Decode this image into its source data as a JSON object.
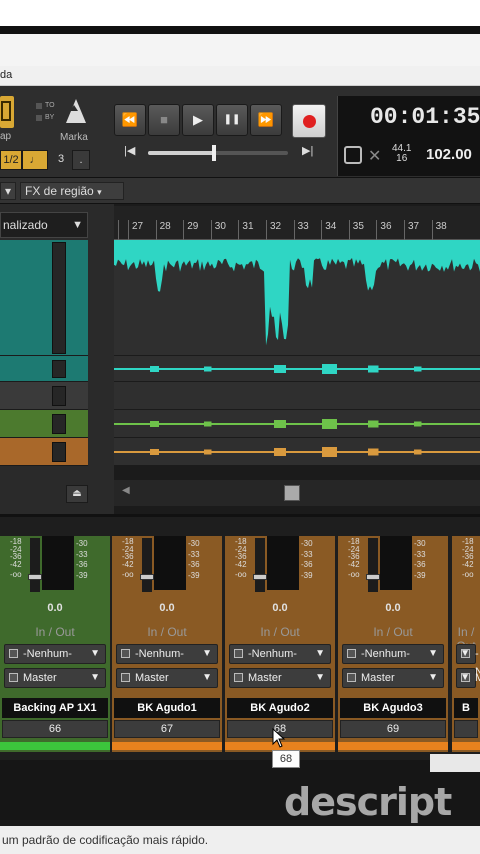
{
  "menubar": {
    "item": "da"
  },
  "toolbar": {
    "snap_label": "ap",
    "to_label": "TO",
    "by_label": "BY",
    "marka_label": "Marka",
    "grid_values": [
      "1/2",
      "♩",
      "3",
      "."
    ]
  },
  "transport": {
    "rewind": "⏪",
    "stop": "■",
    "play": "▶",
    "pause": "❚❚",
    "forward": "⏩",
    "go_start": "|◀",
    "go_end": "▶|",
    "position_fraction": 0.47
  },
  "timecode": {
    "time": "00:01:35:",
    "sample_rate": "44.1",
    "bit_depth": "16",
    "tempo": "102.00"
  },
  "fxbar": {
    "left_dropdown": "▾",
    "fx_label": "FX de região"
  },
  "preset": {
    "label": "nalizado"
  },
  "ruler": {
    "bars": [
      "27",
      "28",
      "29",
      "30",
      "31",
      "32",
      "33",
      "34",
      "35",
      "36",
      "37",
      "38"
    ]
  },
  "tracks": [
    {
      "color": "#1d7a72",
      "waveform": "#2fd6c4"
    },
    {
      "color": "#1d7a72",
      "waveform": "#2fd6c4"
    },
    {
      "color": "#3a3a3a",
      "waveform": "#888888"
    },
    {
      "color": "#4c7a2e",
      "waveform": "#6ec24a"
    },
    {
      "color": "#a9682a",
      "waveform": "#d99a3e"
    }
  ],
  "mixer": {
    "scale": [
      "-18",
      "-24",
      "-36",
      "-42",
      "-oo"
    ],
    "meter_scale": [
      "-30",
      "-33",
      "-36",
      "-39"
    ],
    "inout": "In / Out",
    "input": "-Nenhum-",
    "output": "Master",
    "strips": [
      {
        "name": "Backing AP 1X1",
        "number": "66",
        "db": "0.0",
        "color": "#3f6a2c",
        "bar": "#3cc43c"
      },
      {
        "name": "BK Agudo1",
        "number": "67",
        "db": "0.0",
        "color": "#8a5a24",
        "bar": "#e8821e"
      },
      {
        "name": "BK Agudo2",
        "number": "68",
        "db": "0.0",
        "color": "#8a5a24",
        "bar": "#e8821e"
      },
      {
        "name": "BK Agudo3",
        "number": "69",
        "db": "0.0",
        "color": "#8a5a24",
        "bar": "#e8821e"
      },
      {
        "name": "B",
        "number": "",
        "db": "",
        "color": "#8a5a24",
        "bar": "#e8821e"
      }
    ]
  },
  "tooltip": "68",
  "watermark": "descript",
  "statusbar": "um padrão de codificação mais rápido."
}
